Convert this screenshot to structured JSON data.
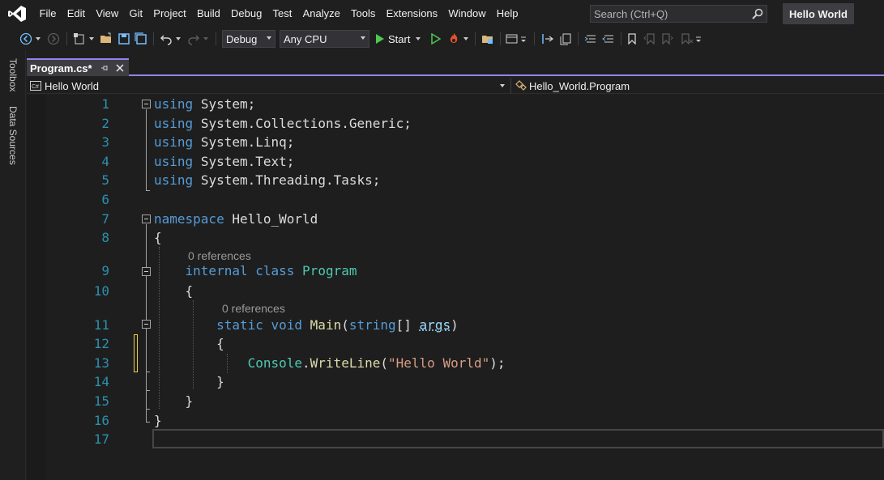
{
  "menu": {
    "items": [
      "File",
      "Edit",
      "View",
      "Git",
      "Project",
      "Build",
      "Debug",
      "Test",
      "Analyze",
      "Tools",
      "Extensions",
      "Window",
      "Help"
    ]
  },
  "search": {
    "placeholder": "Search (Ctrl+Q)"
  },
  "solution_name": "Hello World",
  "toolbar": {
    "configuration": "Debug",
    "platform": "Any CPU",
    "start_label": "Start"
  },
  "side_tabs": [
    "Toolbox",
    "Data Sources"
  ],
  "document_tab": {
    "label": "Program.cs*"
  },
  "navbar": {
    "project": "Hello World",
    "type": "Hello_World.Program"
  },
  "code_lens": {
    "program_refs": "0 references",
    "main_refs": "0 references"
  },
  "editor": {
    "line_numbers": [
      "1",
      "2",
      "3",
      "4",
      "5",
      "6",
      "7",
      "8",
      "9",
      "10",
      "11",
      "12",
      "13",
      "14",
      "15",
      "16",
      "17"
    ],
    "tokens": {
      "using": "using",
      "ns_system": "System",
      "semi": ";",
      "dot": ".",
      "collections": "Collections",
      "generic": "Generic",
      "linq": "Linq",
      "text": "Text",
      "threading": "Threading",
      "tasks": "Tasks",
      "namespace": "namespace",
      "hello_world": "Hello_World",
      "open_brace": "{",
      "close_brace": "}",
      "internal": "internal",
      "class": "class",
      "program": "Program",
      "static": "static",
      "void": "void",
      "main": "Main",
      "open_paren": "(",
      "string_kw": "string",
      "brackets": "[]",
      "args": "args",
      "close_paren": ")",
      "console": "Console",
      "writeline": "WriteLine",
      "hello_literal": "\"Hello World\"",
      "close_call": ");"
    }
  },
  "colors": {
    "accent": "#9184ee",
    "keyword": "#569cd6",
    "type": "#4ec9b0",
    "method": "#dcdcaa",
    "string": "#d69d85",
    "line_number": "#2b91af",
    "change_indicator": "#efd04a"
  },
  "icons": [
    "vs-logo-icon",
    "search-icon",
    "back-icon",
    "forward-icon",
    "new-project-icon",
    "open-folder-icon",
    "save-icon",
    "save-all-icon",
    "undo-icon",
    "redo-icon",
    "start-icon",
    "start-without-debugging-icon",
    "hot-reload-icon",
    "pin-icon",
    "close-icon",
    "csharp-project-icon",
    "class-icon",
    "bookmark-icon"
  ]
}
